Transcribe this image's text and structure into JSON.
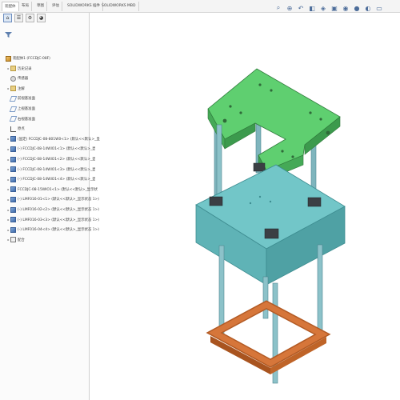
{
  "tabs": [
    "装配体",
    "布局",
    "草图",
    "评估",
    "SOLIDWORKS 插件",
    "SOLIDWORKS MBD"
  ],
  "hud_icons": [
    "zoom-to-fit-icon",
    "zoom-area-icon",
    "previous-view-icon",
    "section-view-icon",
    "view-orientation-icon",
    "display-style-icon",
    "hide-show-icon",
    "edit-appearance-icon",
    "scene-icon",
    "display-settings-icon"
  ],
  "panel_tabs": [
    "feature-manager-icon",
    "property-manager-icon",
    "configuration-manager-icon",
    "display-manager-icon"
  ],
  "tree": [
    {
      "icon": "asm",
      "label": "装配体1 (FCCDJC-08F)",
      "caret": ""
    },
    {
      "icon": "folder",
      "label": "历史记录",
      "caret": "▸"
    },
    {
      "icon": "sensor",
      "label": "传感器",
      "caret": ""
    },
    {
      "icon": "folder",
      "label": "注解",
      "caret": "▸"
    },
    {
      "icon": "plane",
      "label": "前视基准面",
      "caret": ""
    },
    {
      "icon": "plane",
      "label": "上视基准面",
      "caret": ""
    },
    {
      "icon": "plane",
      "label": "右视基准面",
      "caret": ""
    },
    {
      "icon": "origin",
      "label": "原点",
      "caret": ""
    },
    {
      "icon": "part",
      "label": "(固定) FCCDJC-08-801W0<1> (默认<<默认>_显",
      "caret": "▸"
    },
    {
      "icon": "part",
      "label": "(-) FCCDJC-08-14WIO1<1> (默认<<默认>_显",
      "caret": "▸"
    },
    {
      "icon": "part",
      "label": "(-) FCCDJC-08-14WIO1<2> (默认<<默认>_显",
      "caret": "▸"
    },
    {
      "icon": "part",
      "label": "(-) FCCDJC-08-14WIO1<3> (默认<<默认>_显",
      "caret": "▸"
    },
    {
      "icon": "part",
      "label": "(-) FCCDJC-08-14WIO1<4> (默认<<默认>_显",
      "caret": "▸"
    },
    {
      "icon": "part",
      "label": "FCCDJC-08-15WIO1<1> (默认<<默认>_显示状",
      "caret": "▸"
    },
    {
      "icon": "part",
      "label": "(-) LMF016-01<1> (默认<<默认>_显示状态 1>)",
      "caret": "▸"
    },
    {
      "icon": "part",
      "label": "(-) LMF016-02<2> (默认<<默认>_显示状态 1>)",
      "caret": "▸"
    },
    {
      "icon": "part",
      "label": "(-) LMF016-03<3> (默认<<默认>_显示状态 1>)",
      "caret": "▸"
    },
    {
      "icon": "part",
      "label": "(-) LMF016-04<4> (默认<<默认>_显示状态 1>)",
      "caret": "▸"
    },
    {
      "icon": "mate",
      "label": "配合",
      "caret": "▸"
    }
  ],
  "colors": {
    "plate_green": "#5fcf70",
    "block_teal": "#72c6c8",
    "base_orange": "#d6763a",
    "rod": "#7fb5bd"
  }
}
